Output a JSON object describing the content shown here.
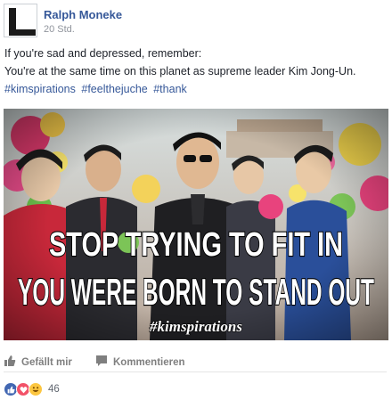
{
  "post": {
    "author": "Ralph Moneke",
    "timestamp": "20 Std.",
    "text_lines": [
      "If you're sad and depressed, remember:",
      "You're at the same time on this planet as supreme leader Kim Jong-Un."
    ],
    "hashtags": [
      "#kimspirations",
      "#feelthejuche",
      "#thank"
    ]
  },
  "image": {
    "caption_line1": "STOP TRYING TO FIT IN",
    "caption_line2": "YOU WERE BORN TO STAND OUT",
    "hashtag": "#kimspirations"
  },
  "actions": {
    "like_label": "Gefällt mir",
    "comment_label": "Kommentieren"
  },
  "reactions": {
    "icons": [
      "like-icon",
      "love-icon",
      "haha-icon"
    ],
    "count": "46",
    "colors": {
      "like": "#4267b2",
      "love": "#f25268",
      "haha": "#fcc640"
    }
  },
  "colors": {
    "link": "#365899",
    "muted": "#90949c"
  }
}
